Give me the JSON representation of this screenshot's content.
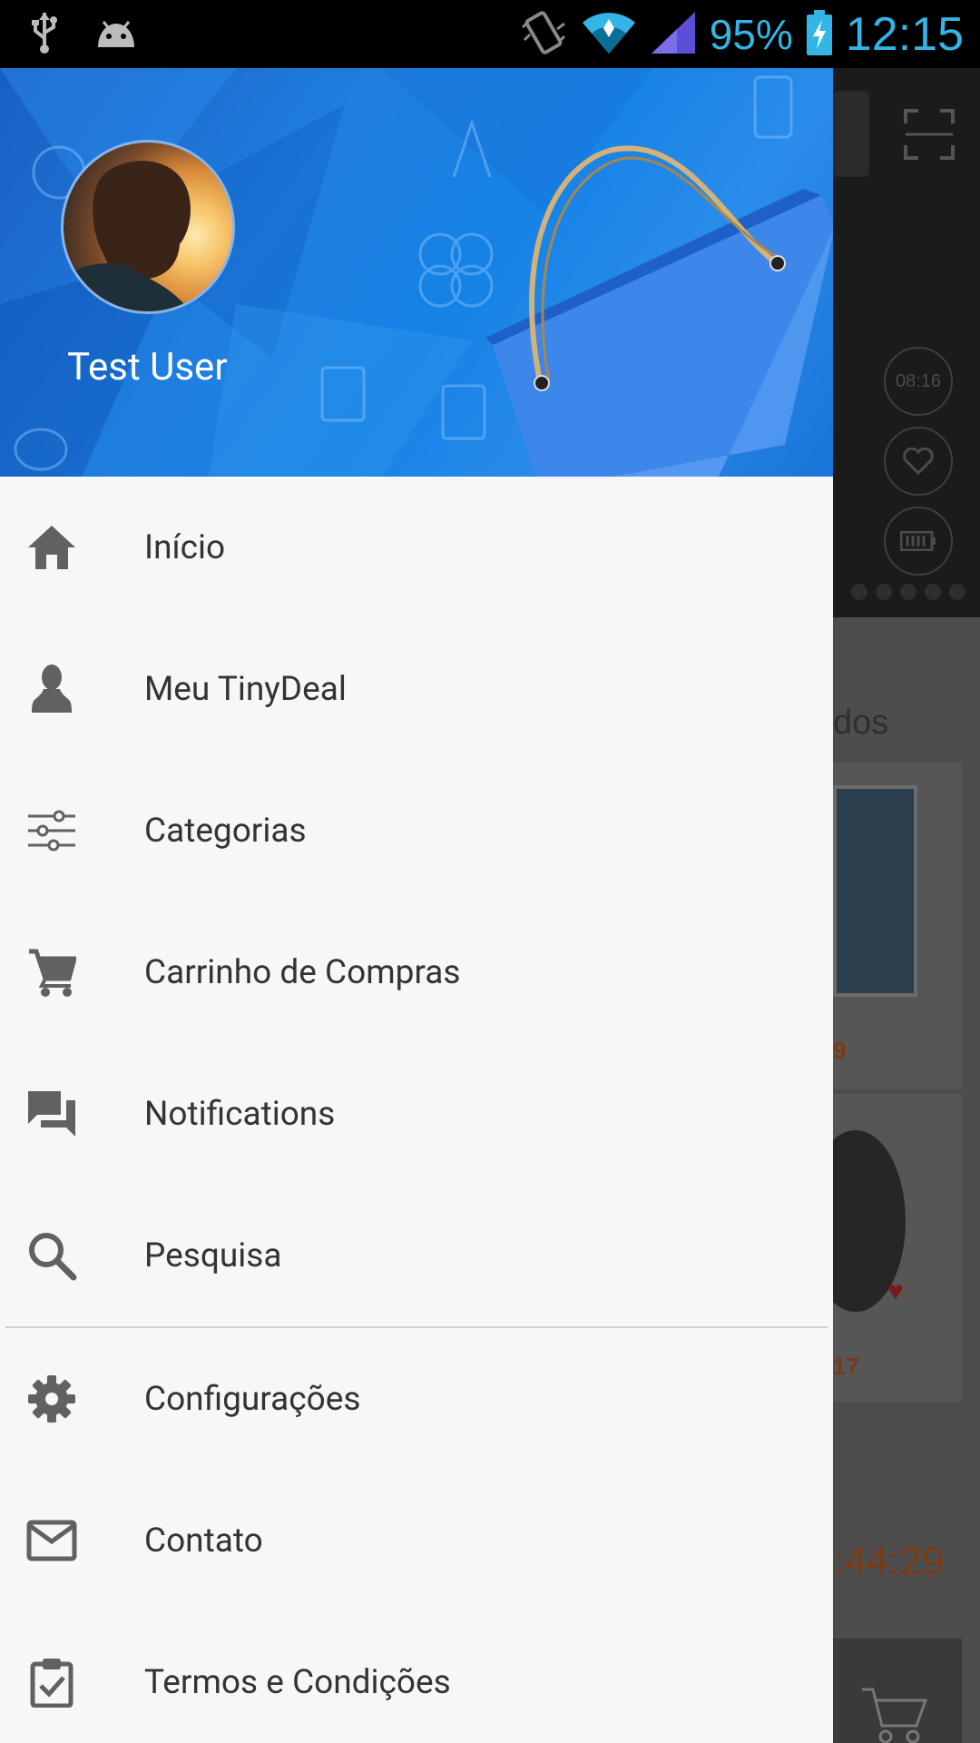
{
  "status_bar": {
    "battery": "95%",
    "time": "12:15",
    "icons": [
      "usb-icon",
      "android-debug-icon",
      "vibrate-icon",
      "wifi-icon",
      "signal-icon",
      "battery-charging-icon"
    ]
  },
  "drawer": {
    "header": {
      "user_name": "Test User",
      "accent_color": "#1a7ee0"
    },
    "menu_items": [
      {
        "label": "Início",
        "icon": "home-icon"
      },
      {
        "label": "Meu TinyDeal",
        "icon": "person-icon"
      },
      {
        "label": "Categorias",
        "icon": "sliders-icon"
      },
      {
        "label": "Carrinho de Compras",
        "icon": "cart-icon"
      },
      {
        "label": "Notifications",
        "icon": "chat-icon"
      },
      {
        "label": "Pesquisa",
        "icon": "search-icon"
      }
    ],
    "secondary_items": [
      {
        "label": "Configurações",
        "icon": "gear-icon"
      },
      {
        "label": "Contato",
        "icon": "mail-icon"
      },
      {
        "label": "Termos e Condições",
        "icon": "clipboard-check-icon"
      }
    ]
  },
  "background_app": {
    "watch_time": "08:16",
    "section_title_fragment": "dos",
    "price_1": "9",
    "price_2": "17",
    "countdown": ":44:29"
  }
}
